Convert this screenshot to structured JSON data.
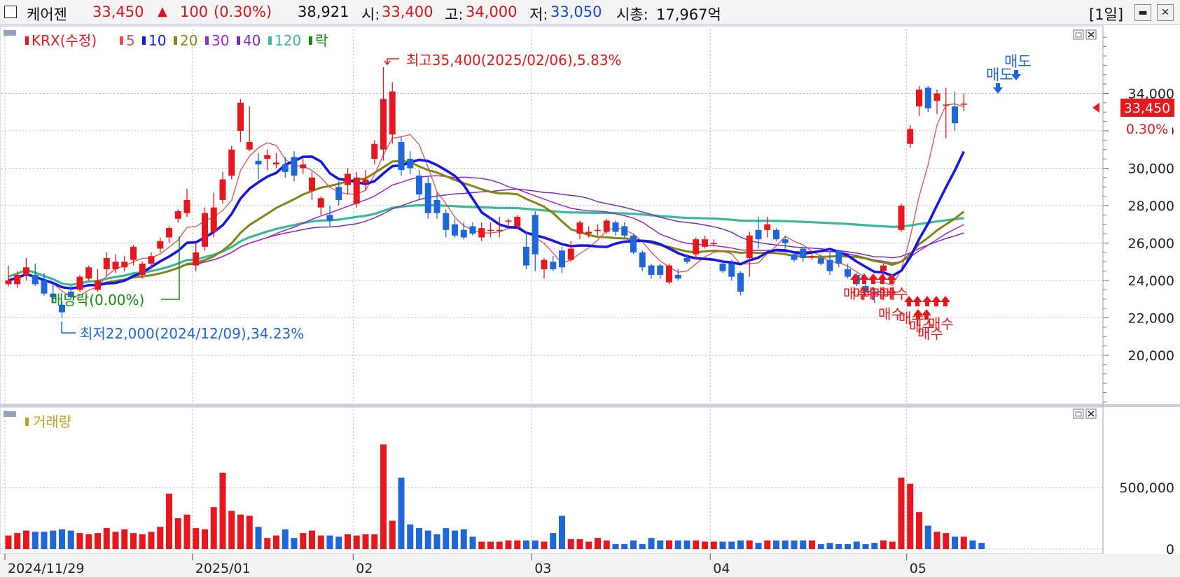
{
  "header": {
    "name": "케어젠",
    "price": "33,450",
    "change_arrow": "▲",
    "change": "100",
    "change_pct": "(0.30%)",
    "volume": "38,921",
    "open_label": "시:",
    "open": "33,400",
    "high_label": "고:",
    "high": "34,000",
    "low_label": "저:",
    "low": "33,050",
    "mcap_label": "시총:",
    "mcap": "17,967억",
    "period": "[1일]",
    "min_button": "▬",
    "close_button": "✕"
  },
  "colors": {
    "up": "#e8171e",
    "down": "#1f66d9",
    "ma5": "#e05050",
    "ma10": "#1616e8",
    "ma20": "#848418",
    "ma30": "#9c28c8",
    "ma40": "#7030b8",
    "ma120": "#3cb89a"
  },
  "price_panel": {
    "legend": [
      {
        "label": "KRX(수정)",
        "color": "#e8171e",
        "sw": "#e8171e"
      },
      {
        "label": "5",
        "color": "#e05050",
        "sw": "#e05050"
      },
      {
        "label": "10",
        "color": "#1616e8",
        "sw": "#1616e8"
      },
      {
        "label": "20",
        "color": "#848418",
        "sw": "#848418"
      },
      {
        "label": "30",
        "color": "#9c28c8",
        "sw": "#9c28c8"
      },
      {
        "label": "40",
        "color": "#7030b8",
        "sw": "#7030b8"
      },
      {
        "label": "120",
        "color": "#3cb89a",
        "sw": "#3cb89a"
      },
      {
        "label": "락",
        "color": "#138a13",
        "sw": "#138a13"
      }
    ],
    "annotations": {
      "high": "최고35,400(2025/02/06),5.83%",
      "low": "최저22,000(2024/12/09),34.23%",
      "ex_rights": "배당락(0.00%)"
    },
    "price_tag": "33,450",
    "pct_tag": "0.30%"
  },
  "volume_panel": {
    "legend": "거래량"
  },
  "signals": {
    "buy": "매수",
    "sell": "매도"
  },
  "chart_data": {
    "type": "candlestick",
    "x": [
      "2024/11/29",
      "2024/12/02",
      "2024/12/03",
      "2024/12/04",
      "2024/12/05",
      "2024/12/06",
      "2024/12/09",
      "2024/12/10",
      "2024/12/11",
      "2024/12/12",
      "2024/12/13",
      "2024/12/16",
      "2024/12/17",
      "2024/12/18",
      "2024/12/19",
      "2024/12/20",
      "2024/12/23",
      "2024/12/24",
      "2024/12/26",
      "2024/12/27",
      "2024/12/30",
      "2025/01/02",
      "2025/01/03",
      "2025/01/06",
      "2025/01/07",
      "2025/01/08",
      "2025/01/09",
      "2025/01/10",
      "2025/01/13",
      "2025/01/14",
      "2025/01/15",
      "2025/01/16",
      "2025/01/17",
      "2025/01/20",
      "2025/01/21",
      "2025/01/22",
      "2025/01/23",
      "2025/01/24",
      "2025/01/31",
      "2025/02/03",
      "2025/02/04",
      "2025/02/05",
      "2025/02/06",
      "2025/02/07",
      "2025/02/10",
      "2025/02/11",
      "2025/02/12",
      "2025/02/13",
      "2025/02/14",
      "2025/02/17",
      "2025/02/18",
      "2025/02/19",
      "2025/02/20",
      "2025/02/21",
      "2025/02/24",
      "2025/02/25",
      "2025/02/26",
      "2025/02/27",
      "2025/02/28",
      "2025/03/04",
      "2025/03/05",
      "2025/03/06",
      "2025/03/07",
      "2025/03/10",
      "2025/03/11",
      "2025/03/12",
      "2025/03/13",
      "2025/03/14",
      "2025/03/17",
      "2025/03/18",
      "2025/03/19",
      "2025/03/20",
      "2025/03/21",
      "2025/03/24",
      "2025/03/25",
      "2025/03/26",
      "2025/03/27",
      "2025/03/28",
      "2025/03/31",
      "2025/04/01",
      "2025/04/02",
      "2025/04/03",
      "2025/04/04",
      "2025/04/07",
      "2025/04/08",
      "2025/04/09",
      "2025/04/10",
      "2025/04/11",
      "2025/04/14",
      "2025/04/15",
      "2025/04/16",
      "2025/04/17",
      "2025/04/18",
      "2025/04/21",
      "2025/04/22",
      "2025/04/23",
      "2025/04/24",
      "2025/04/25",
      "2025/04/28",
      "2025/04/29",
      "2025/04/30",
      "2025/05/02",
      "2025/05/07",
      "2025/05/08",
      "2025/05/09",
      "2025/05/12",
      "2025/05/13",
      "2025/05/14",
      "2025/05/15",
      "2025/05/16",
      "2025/05/19",
      "2025/05/20"
    ],
    "open": [
      23800,
      23800,
      24300,
      24300,
      24000,
      23300,
      22700,
      23400,
      23500,
      24100,
      23500,
      24600,
      24600,
      24700,
      25100,
      24300,
      24900,
      25700,
      26300,
      27300,
      27600,
      24800,
      25800,
      26600,
      28300,
      29600,
      32000,
      31000,
      30400,
      30500,
      30200,
      30200,
      30600,
      30000,
      28800,
      27900,
      27500,
      29000,
      29100,
      28100,
      29200,
      30500,
      31000,
      31800,
      31400,
      30500,
      29600,
      29200,
      28300,
      27600,
      27000,
      26700,
      26900,
      26300,
      26700,
      26700,
      27200,
      26900,
      25800,
      27500,
      24600,
      25000,
      25600,
      25100,
      26500,
      26500,
      26700,
      26600,
      27100,
      26900,
      26400,
      25500,
      24800,
      24800,
      23900,
      24300,
      25200,
      25400,
      25800,
      26000,
      24900,
      24900,
      24400,
      25200,
      26700,
      26700,
      26700,
      26200,
      25400,
      25700,
      25300,
      25200,
      25100,
      25600,
      24600,
      24300,
      23700,
      23400,
      24500,
      23300,
      26700,
      31300,
      33300,
      34300,
      33600,
      33400,
      33300,
      33400
    ],
    "close": [
      24000,
      24300,
      24700,
      23800,
      23300,
      23100,
      22300,
      23100,
      24200,
      24700,
      24000,
      25200,
      25000,
      25000,
      25800,
      24900,
      25300,
      26100,
      26800,
      27700,
      28300,
      25500,
      27600,
      27900,
      29400,
      31000,
      33500,
      31400,
      30200,
      30700,
      30300,
      29800,
      29600,
      30200,
      29500,
      28400,
      27200,
      28300,
      29700,
      29500,
      29400,
      31300,
      33700,
      34100,
      29900,
      30000,
      28600,
      27600,
      27600,
      26700,
      26400,
      26300,
      26500,
      26800,
      26700,
      26700,
      27200,
      27400,
      24800,
      25400,
      25100,
      24600,
      24700,
      25700,
      27100,
      26600,
      26700,
      27200,
      26600,
      26400,
      25500,
      24700,
      24300,
      24300,
      24800,
      24100,
      25000,
      26200,
      26200,
      26000,
      24500,
      24200,
      23400,
      26400,
      26200,
      27000,
      26200,
      26000,
      25100,
      25200,
      25300,
      24900,
      24500,
      24900,
      24200,
      23800,
      23400,
      23300,
      24800,
      23400,
      28000,
      32100,
      34200,
      33200,
      34000,
      33400,
      32400,
      33450
    ],
    "high": [
      24800,
      24500,
      25200,
      24900,
      24400,
      23800,
      22900,
      23700,
      24300,
      24800,
      24600,
      25500,
      25400,
      25300,
      25900,
      25000,
      25500,
      26300,
      26900,
      27800,
      28900,
      26000,
      27900,
      28700,
      29800,
      31200,
      33700,
      33300,
      30800,
      31000,
      30800,
      30600,
      30900,
      30500,
      29800,
      28500,
      28000,
      29300,
      30000,
      29800,
      29900,
      31500,
      35400,
      34600,
      31700,
      30900,
      29900,
      29600,
      28700,
      27800,
      27300,
      27100,
      27100,
      27100,
      27100,
      27400,
      27300,
      27500,
      26600,
      27700,
      25200,
      25300,
      25800,
      26100,
      27200,
      26900,
      27000,
      27300,
      27200,
      27100,
      26500,
      25600,
      24900,
      24900,
      24900,
      24600,
      25400,
      26300,
      26400,
      26200,
      25100,
      25100,
      24500,
      26600,
      27400,
      27400,
      26800,
      26400,
      25500,
      25800,
      25500,
      25400,
      25500,
      25600,
      24900,
      24400,
      24200,
      23600,
      24900,
      23600,
      28100,
      32300,
      34400,
      34400,
      34200,
      34300,
      34100,
      34000
    ],
    "low": [
      23700,
      23600,
      24000,
      23700,
      23200,
      22800,
      22000,
      23000,
      23400,
      24000,
      23400,
      24200,
      24400,
      24500,
      24800,
      24100,
      24600,
      25500,
      26000,
      27100,
      27400,
      24500,
      25600,
      26300,
      28100,
      29400,
      31400,
      30900,
      29400,
      29900,
      30000,
      29500,
      29300,
      29700,
      28300,
      27500,
      26900,
      28000,
      28600,
      27900,
      28800,
      30200,
      30400,
      31300,
      29600,
      29700,
      28300,
      27300,
      27300,
      26300,
      26300,
      26200,
      26400,
      26100,
      26300,
      26300,
      26900,
      26800,
      24600,
      24500,
      24100,
      24500,
      24400,
      25000,
      26200,
      26300,
      26400,
      26500,
      26400,
      26300,
      25400,
      24500,
      24100,
      24100,
      23800,
      24000,
      24900,
      25100,
      25700,
      25800,
      24400,
      24000,
      23200,
      24200,
      25700,
      26300,
      26100,
      25700,
      25000,
      25000,
      25100,
      24800,
      24300,
      24700,
      24100,
      23700,
      23200,
      22800,
      23800,
      23100,
      26600,
      31100,
      32800,
      33000,
      32900,
      31600,
      32000,
      33050
    ],
    "volume": [
      110000,
      130000,
      150000,
      140000,
      140000,
      150000,
      160000,
      150000,
      130000,
      120000,
      130000,
      170000,
      140000,
      160000,
      130000,
      120000,
      140000,
      180000,
      450000,
      250000,
      280000,
      170000,
      160000,
      340000,
      620000,
      310000,
      280000,
      270000,
      180000,
      90000,
      110000,
      160000,
      90000,
      130000,
      150000,
      110000,
      110000,
      100000,
      120000,
      110000,
      120000,
      120000,
      850000,
      230000,
      580000,
      200000,
      170000,
      150000,
      120000,
      170000,
      150000,
      160000,
      100000,
      60000,
      60000,
      60000,
      70000,
      70000,
      70000,
      70000,
      60000,
      130000,
      270000,
      80000,
      80000,
      60000,
      90000,
      70000,
      40000,
      40000,
      70000,
      40000,
      90000,
      70000,
      70000,
      70000,
      70000,
      70000,
      60000,
      60000,
      60000,
      60000,
      70000,
      70000,
      50000,
      70000,
      70000,
      70000,
      70000,
      70000,
      70000,
      40000,
      50000,
      40000,
      40000,
      60000,
      40000,
      50000,
      70000,
      60000,
      580000,
      530000,
      300000,
      190000,
      140000,
      130000,
      100000,
      100000,
      70000,
      50000
    ],
    "moving_averages": {
      "periods": [
        5,
        10,
        20,
        30,
        40,
        120
      ]
    },
    "ylim": [
      17000,
      37000
    ],
    "yticks": [
      20000,
      22000,
      24000,
      26000,
      28000,
      30000,
      32000,
      34000
    ],
    "ytick_labels": [
      "20,000",
      "22,000",
      "24,000",
      "26,000",
      "28,000",
      "30,000",
      "32,000",
      "34,000"
    ],
    "volume_ylim": [
      0,
      880000
    ],
    "volume_yticks": [
      0,
      500000
    ],
    "volume_ytick_labels": [
      "0",
      "500,000"
    ],
    "xtick_labels": [
      "2024/11/29",
      "2025/01",
      "02",
      "03",
      "04",
      "05"
    ],
    "xtick_dates": [
      "2024/11/29",
      "2025/01/02",
      "2025/02/03",
      "2025/03/04",
      "2025/04/01",
      "2025/05/02"
    ],
    "grid": true
  }
}
